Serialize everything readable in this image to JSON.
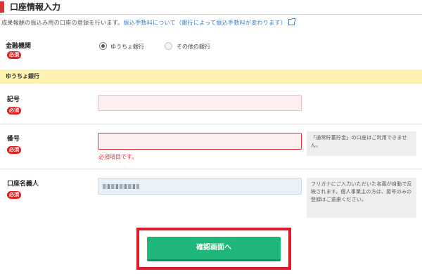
{
  "header": {
    "title": "口座情報入力"
  },
  "description": {
    "text": "成果報酬の振込み用の口座の登録を行います。",
    "link": "振込手数料について（銀行によって振込手数料が変わります）",
    "link_icon": "external-link-icon"
  },
  "required_label": "必須",
  "institution": {
    "label": "金融機関",
    "options": [
      {
        "label": "ゆうちょ銀行",
        "selected": true
      },
      {
        "label": "その他の銀行",
        "selected": false
      }
    ]
  },
  "section": {
    "title": "ゆうちょ銀行"
  },
  "symbol": {
    "label": "記号",
    "value": ""
  },
  "number": {
    "label": "番号",
    "value": "",
    "error": "必須項目です。",
    "note": "「通常貯蓄貯金」の口座はご利用できません。"
  },
  "holder": {
    "label": "口座名義人",
    "value_masked": true,
    "note": "フリガナにご入力いただいた名義が自動で反映されます。個人事業主の方は、屋号のみの登録はご遠慮ください。"
  },
  "submit": {
    "label": "確認画面へ"
  },
  "colors": {
    "accent": "#d9343a",
    "submit": "#1fb67a",
    "section_bg": "#fdf1b0",
    "highlight": "#e01a2a"
  }
}
